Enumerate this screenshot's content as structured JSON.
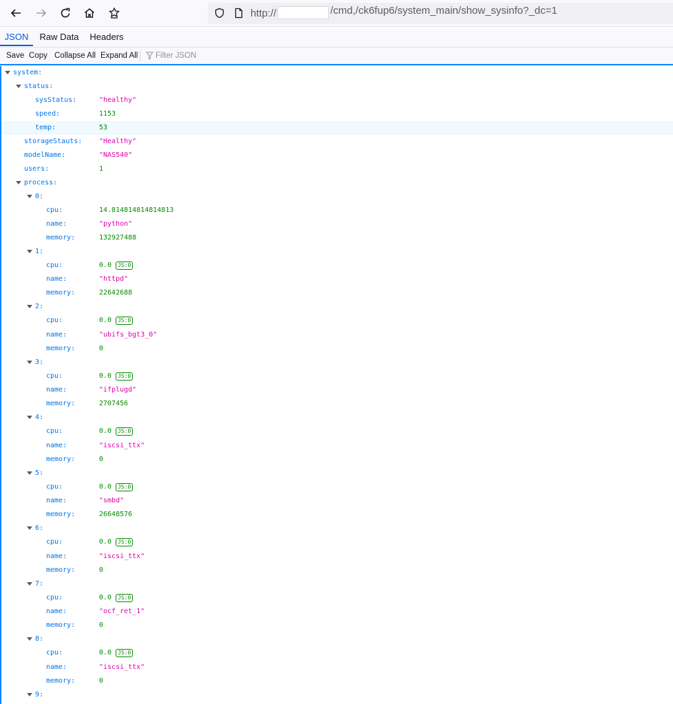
{
  "browser": {
    "url_prefix": "http://",
    "url_suffix": "/cmd,/ck6fup6/system_main/show_sysinfo?_dc=1"
  },
  "viewer": {
    "tabs": [
      "JSON",
      "Raw Data",
      "Headers"
    ],
    "actions": [
      "Save",
      "Copy",
      "Collapse All",
      "Expand All"
    ],
    "filter_placeholder": "Filter JSON"
  },
  "json": {
    "system_key": "system:",
    "status_key": "status:",
    "sysStatus_key": "sysStatus:",
    "sysStatus": "\"healthy\"",
    "speed_key": "speed:",
    "speed": "1153",
    "temp_key": "temp:",
    "temp": "53",
    "storageStauts_key": "storageStauts:",
    "storageStauts": "\"Healthy\"",
    "modelName_key": "modelName:",
    "modelName": "\"NAS540\"",
    "users_key": "users:",
    "users": "1",
    "process_key": "process:",
    "badge_text": "JS:0",
    "process": [
      {
        "index": "0:",
        "cpu": "14.814814814814813",
        "name": "\"python\"",
        "memory": "132927488"
      },
      {
        "index": "1:",
        "cpu": "0.0",
        "name": "\"httpd\"",
        "memory": "22642688"
      },
      {
        "index": "2:",
        "cpu": "0.0",
        "name": "\"ubifs_bgt3_0\"",
        "memory": "0"
      },
      {
        "index": "3:",
        "cpu": "0.0",
        "name": "\"ifplugd\"",
        "memory": "2707456"
      },
      {
        "index": "4:",
        "cpu": "0.0",
        "name": "\"iscsi_ttx\"",
        "memory": "0"
      },
      {
        "index": "5:",
        "cpu": "0.0",
        "name": "\"smbd\"",
        "memory": "26648576"
      },
      {
        "index": "6:",
        "cpu": "0.0",
        "name": "\"iscsi_ttx\"",
        "memory": "0"
      },
      {
        "index": "7:",
        "cpu": "0.0",
        "name": "\"ocf_ret_1\"",
        "memory": "0"
      },
      {
        "index": "8:",
        "cpu": "0.0",
        "name": "\"iscsi_ttx\"",
        "memory": "0"
      },
      {
        "index": "9:"
      }
    ],
    "cpu_key": "cpu:",
    "name_key": "name:",
    "memory_key": "memory:"
  },
  "icons": [
    "back-arrow-icon",
    "forward-arrow-icon",
    "reload-icon",
    "home-icon",
    "pocket-icon",
    "shield-icon",
    "page-icon",
    "filter-icon",
    "disclosure-triangle-icon"
  ]
}
